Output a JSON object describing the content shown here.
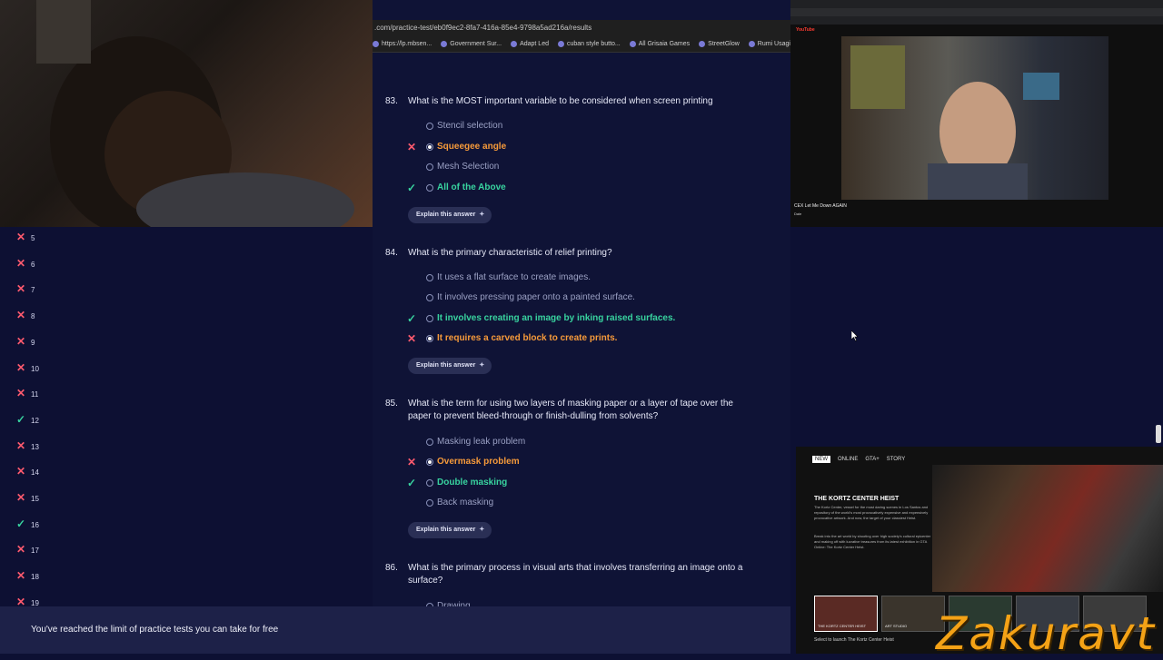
{
  "browser": {
    "url": ".com/practice-test/eb0f9ec2-8fa7-416a-85e4-9798a5ad216a/results",
    "bookmarks": [
      "https://lp.mbsen...",
      "Government Sur...",
      "Adapt Led",
      "cuban style butto...",
      "All Grisaia Games",
      "StreetGlow",
      "Rumi Usagiyama..."
    ]
  },
  "sidebar": {
    "items": [
      {
        "num": "5",
        "status": "wrong"
      },
      {
        "num": "6",
        "status": "wrong"
      },
      {
        "num": "7",
        "status": "wrong"
      },
      {
        "num": "8",
        "status": "wrong"
      },
      {
        "num": "9",
        "status": "wrong"
      },
      {
        "num": "10",
        "status": "wrong"
      },
      {
        "num": "11",
        "status": "wrong"
      },
      {
        "num": "12",
        "status": "correct"
      },
      {
        "num": "13",
        "status": "wrong"
      },
      {
        "num": "14",
        "status": "wrong"
      },
      {
        "num": "15",
        "status": "wrong"
      },
      {
        "num": "16",
        "status": "correct"
      },
      {
        "num": "17",
        "status": "wrong"
      },
      {
        "num": "18",
        "status": "wrong"
      },
      {
        "num": "19",
        "status": "wrong"
      }
    ]
  },
  "questions": [
    {
      "num": "83.",
      "text": "What is the MOST important variable to be considered when screen printing",
      "options": [
        {
          "label": "Stencil selection",
          "state": "none",
          "selected": false
        },
        {
          "label": "Squeegee angle",
          "state": "wrong",
          "selected": true
        },
        {
          "label": "Mesh Selection",
          "state": "none",
          "selected": false
        },
        {
          "label": "All of the Above",
          "state": "right",
          "selected": false
        }
      ],
      "explain": "Explain this answer"
    },
    {
      "num": "84.",
      "text": "What is the primary characteristic of relief printing?",
      "options": [
        {
          "label": "It uses a flat surface to create images.",
          "state": "none",
          "selected": false
        },
        {
          "label": "It involves pressing paper onto a painted surface.",
          "state": "none",
          "selected": false
        },
        {
          "label": "It involves creating an image by inking raised surfaces.",
          "state": "right",
          "selected": false
        },
        {
          "label": "It requires a carved block to create prints.",
          "state": "wrong",
          "selected": true
        }
      ],
      "explain": "Explain this answer"
    },
    {
      "num": "85.",
      "text": "What is the term for using two layers of masking paper or a layer of tape over the paper to prevent bleed-through or finish-dulling from solvents?",
      "options": [
        {
          "label": "Masking leak problem",
          "state": "none",
          "selected": false
        },
        {
          "label": "Overmask problem",
          "state": "wrong",
          "selected": true
        },
        {
          "label": "Double masking",
          "state": "right",
          "selected": false
        },
        {
          "label": "Back masking",
          "state": "none",
          "selected": false
        }
      ],
      "explain": "Explain this answer"
    },
    {
      "num": "86.",
      "text": "What is the primary process in visual arts that involves transferring an image onto a surface?",
      "options": [
        {
          "label": "Drawing",
          "state": "none",
          "selected": false
        }
      ]
    }
  ],
  "banner": "You've reached the limit of practice tests you can take for free",
  "youtube": {
    "logo": "YouTube",
    "title": "CEX Let Me Down AGAIN",
    "channel": "Dale"
  },
  "gta": {
    "nav": [
      "NEW",
      "ONLINE",
      "GTA+",
      "STORY"
    ],
    "title": "THE KORTZ CENTER HEIST",
    "desc": "The Kortz Center, vessel for the most daring scenes in Los Santos and repository of the world's most provocatively expensive and expensively provocative artwork. And now, the target of your classiest Heist.",
    "desc2": "Break into the art world by shooting over high society's cultural epicenter and making off with lucrative treasures from its latest exhibition in GTA Online: The Kortz Center Heist.",
    "thumbs": [
      "THE KORTZ CENTER HEIST",
      "ART STUDIO",
      "",
      "",
      ""
    ],
    "select": "Select to launch The Kortz Center Heist"
  },
  "watermark": "Zakuravt",
  "colors": {
    "wrong": "#f69a3a",
    "right": "#38d39f",
    "x": "#ff5a6e",
    "bg": "#0f1336"
  }
}
